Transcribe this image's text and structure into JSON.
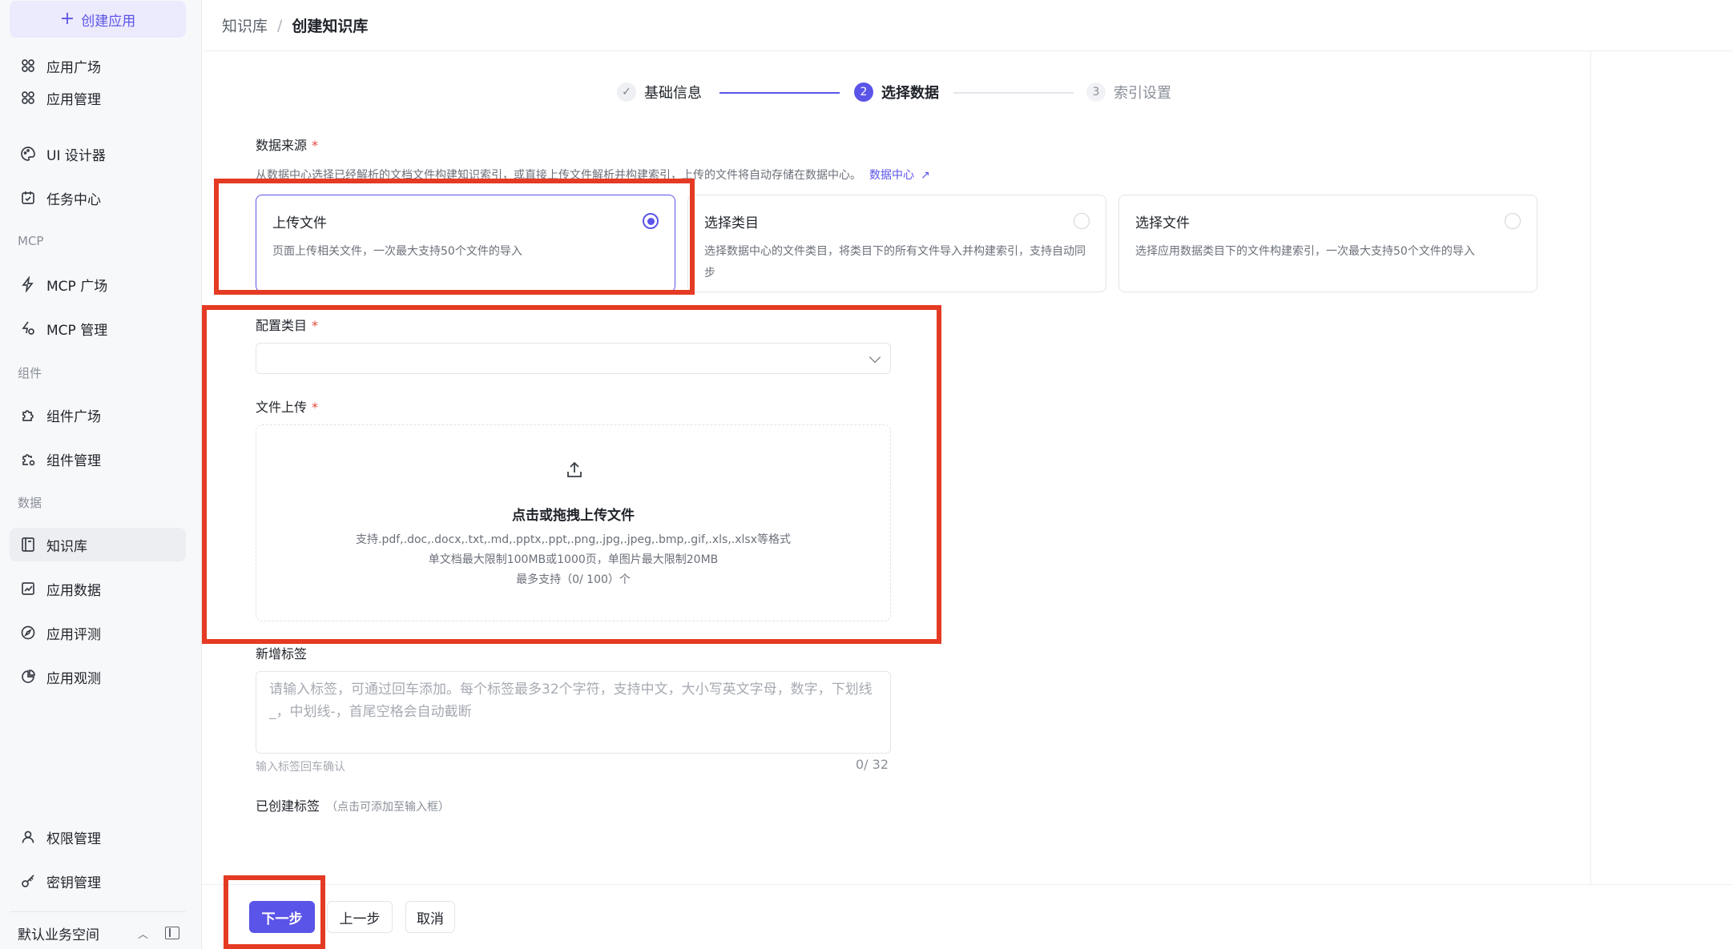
{
  "sidebar": {
    "create_label": "创建应用",
    "items": [
      {
        "label": "应用广场",
        "icon": "grid-icon"
      },
      {
        "label": "应用管理",
        "icon": "grid-icon"
      },
      {
        "label": "UI 设计器",
        "icon": "palette-icon"
      },
      {
        "label": "任务中心",
        "icon": "calendar-check-icon"
      },
      {
        "label": "MCP 广场",
        "icon": "bolt-icon"
      },
      {
        "label": "MCP 管理",
        "icon": "bolt-gear-icon"
      },
      {
        "label": "组件广场",
        "icon": "puzzle-icon"
      },
      {
        "label": "组件管理",
        "icon": "puzzle-gear-icon"
      },
      {
        "label": "知识库",
        "icon": "book-icon"
      },
      {
        "label": "应用数据",
        "icon": "chart-icon"
      },
      {
        "label": "应用评测",
        "icon": "compass-icon"
      },
      {
        "label": "应用观测",
        "icon": "pie-icon"
      },
      {
        "label": "权限管理",
        "icon": "user-icon"
      },
      {
        "label": "密钥管理",
        "icon": "key-icon"
      }
    ],
    "sections": {
      "mcp": "MCP",
      "components": "组件",
      "data": "数据"
    },
    "workspace": "默认业务空间"
  },
  "header": {
    "crumb_root": "知识库",
    "crumb_sep": "/",
    "crumb_current": "创建知识库"
  },
  "steps": [
    {
      "num": "✓",
      "label": "基础信息",
      "state": "done"
    },
    {
      "num": "2",
      "label": "选择数据",
      "state": "current"
    },
    {
      "num": "3",
      "label": "索引设置",
      "state": "pending"
    }
  ],
  "form": {
    "source_label": "数据来源",
    "required_mark": "*",
    "source_desc": "从数据中心选择已经解析的文档文件构建知识索引，或直接上传文件解析并构建索引，上传的文件将自动存储在数据中心。",
    "source_link": "数据中心",
    "source_link_arrow": "↗",
    "cards": [
      {
        "title": "上传文件",
        "desc": "页面上传相关文件，一次最大支持50个文件的导入",
        "selected": true
      },
      {
        "title": "选择类目",
        "desc": "选择数据中心的文件类目，将类目下的所有文件导入并构建索引，支持自动同步",
        "selected": false
      },
      {
        "title": "选择文件",
        "desc": "选择应用数据类目下的文件构建索引，一次最大支持50个文件的导入",
        "selected": false
      }
    ],
    "category_label": "配置类目",
    "category_value": "",
    "upload_label": "文件上传",
    "upload": {
      "title": "点击或拖拽上传文件",
      "formats": "支持.pdf,.doc,.docx,.txt,.md,.pptx,.ppt,.png,.jpg,.jpeg,.bmp,.gif,.xls,.xlsx等格式",
      "limits": "单文档最大限制100MB或1000页，单图片最大限制20MB",
      "max": "最多支持（0/ 100）个"
    },
    "tag_label": "新增标签",
    "tag_placeholder": "请输入标签，可通过回车添加。每个标签最多32个字符，支持中文，大小写英文字母，数字，下划线_，中划线-，首尾空格会自动截断",
    "tag_hint": "输入标签回车确认",
    "tag_count": "0/ 32",
    "created_tags_label": "已创建标签",
    "created_tags_note": "（点击可添加至输入框）"
  },
  "footer": {
    "next": "下一步",
    "prev": "上一步",
    "cancel": "取消"
  },
  "colors": {
    "accent": "#5b54e8",
    "annotation_red": "#e53a23",
    "required": "#e5483d"
  }
}
